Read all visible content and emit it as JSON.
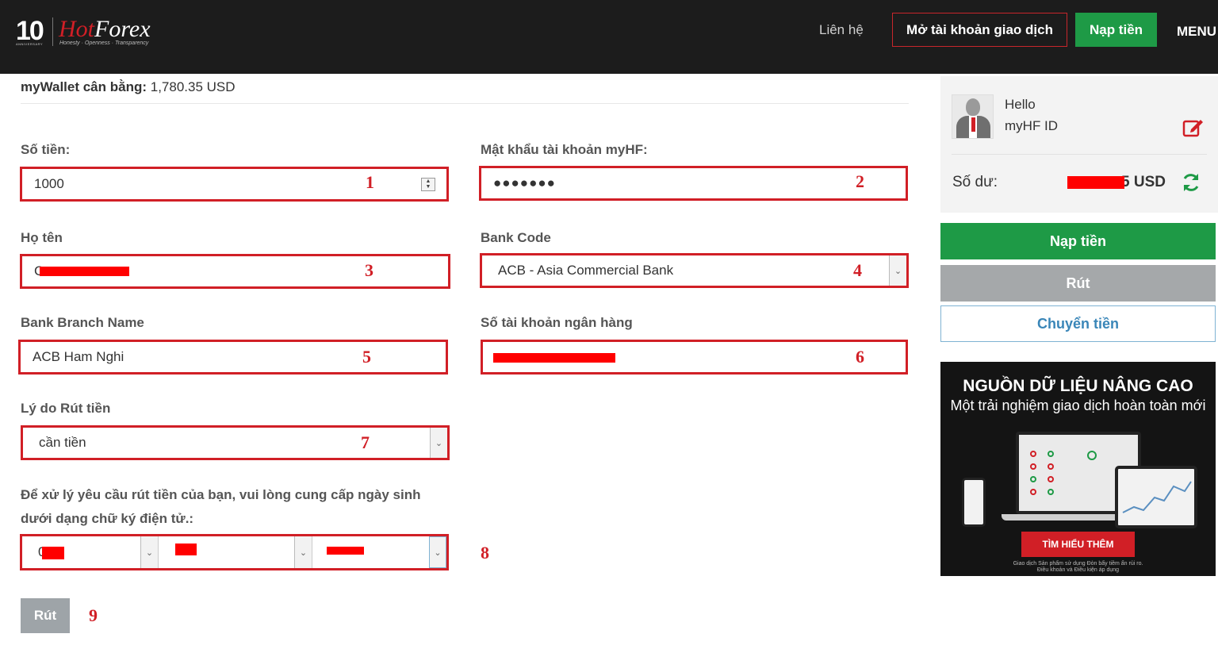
{
  "header": {
    "logo_years": "10",
    "logo_anniversary": "ANNIVERSARY",
    "logo_brand_hot": "Hot",
    "logo_brand_forex": "Forex",
    "logo_tagline": "Honesty · Openness · Transparency",
    "contact_label": "Liên hệ",
    "open_account_label": "Mở tài khoản giao dịch",
    "deposit_label": "Nạp tiền",
    "menu_label": "MENU"
  },
  "form": {
    "balance_label": "myWallet cân bằng:",
    "balance_value": "1,780.35 USD",
    "amount": {
      "label": "Số tiền:",
      "value": "1000",
      "step": "1"
    },
    "password": {
      "label": "Mật khẩu tài khoản myHF:",
      "value": "●●●●●●●",
      "step": "2"
    },
    "full_name": {
      "label": "Họ tên",
      "value": "C",
      "step": "3"
    },
    "bank_code": {
      "label": "Bank Code",
      "value": "ACB - Asia Commercial Bank",
      "step": "4"
    },
    "bank_branch": {
      "label": "Bank Branch Name",
      "value": "ACB Ham Nghi",
      "step": "5"
    },
    "bank_account": {
      "label": "Số tài khoản ngân hàng",
      "value": "",
      "step": "6"
    },
    "reason": {
      "label": "Lý do Rút tiền",
      "value": "cần tiền",
      "step": "7"
    },
    "dob_note": "Để xử lý yêu cầu rút tiền của bạn, vui lòng cung cấp ngày sinh dưới dạng chữ ký điện tử.:",
    "dob": {
      "day": "0",
      "month": "",
      "year": "",
      "step": "8"
    },
    "submit_label": "Rút",
    "submit_step": "9"
  },
  "sidebar": {
    "hello": "Hello",
    "user_id": "myHF ID",
    "balance_label": "Số dư:",
    "balance_suffix": "5 USD",
    "deposit_label": "Nạp tiền",
    "withdraw_label": "Rút",
    "transfer_label": "Chuyển tiền",
    "banner": {
      "title": "NGUỒN DỮ LIỆU NÂNG CAO",
      "subtitle": "Một trải nghiệm giao dịch hoàn toàn mới",
      "cta": "TÌM HIỂU THÊM",
      "fine_print_1": "Giao dịch Sản phẩm sử dụng Đòn bẩy tiềm ẩn rủi ro.",
      "fine_print_2": "Điều khoản và Điều kiện áp dụng"
    }
  },
  "colors": {
    "header_bg": "#1c1c1c",
    "brand_red": "#d11f26",
    "action_green": "#1e9a46",
    "disabled_gray": "#a5a8aa",
    "link_blue": "#3a86b8"
  },
  "icons": {
    "edit": "edit-icon",
    "refresh": "refresh-icon",
    "dropdown": "chevron-down-icon",
    "spinner": "number-spinner-icon"
  }
}
